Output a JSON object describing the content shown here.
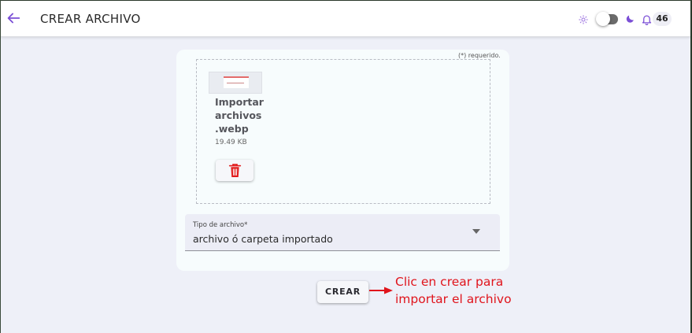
{
  "header": {
    "title": "CREAR ARCHIVO",
    "notification_count": "46"
  },
  "form": {
    "required_note": "(*) requerido.",
    "file": {
      "name": "Importar archivos .webp",
      "size": "19.49 KB"
    },
    "file_type": {
      "label": "Tipo de archivo*",
      "value": "archivo ó carpeta importado"
    },
    "create_label": "CREAR"
  },
  "annotation": {
    "line1": "Clic en crear para",
    "line2": "importar el archivo"
  },
  "icons": {
    "back": "arrow-left-icon",
    "theme_light": "sun-icon",
    "theme_dark": "moon-icon",
    "notifications": "bell-icon",
    "delete": "trash-icon",
    "dropdown": "caret-down-icon",
    "pointer": "red-arrow-icon"
  },
  "colors": {
    "accent": "#7b4fd6",
    "delete": "#e11b1b",
    "annotation": "#e0141c"
  }
}
